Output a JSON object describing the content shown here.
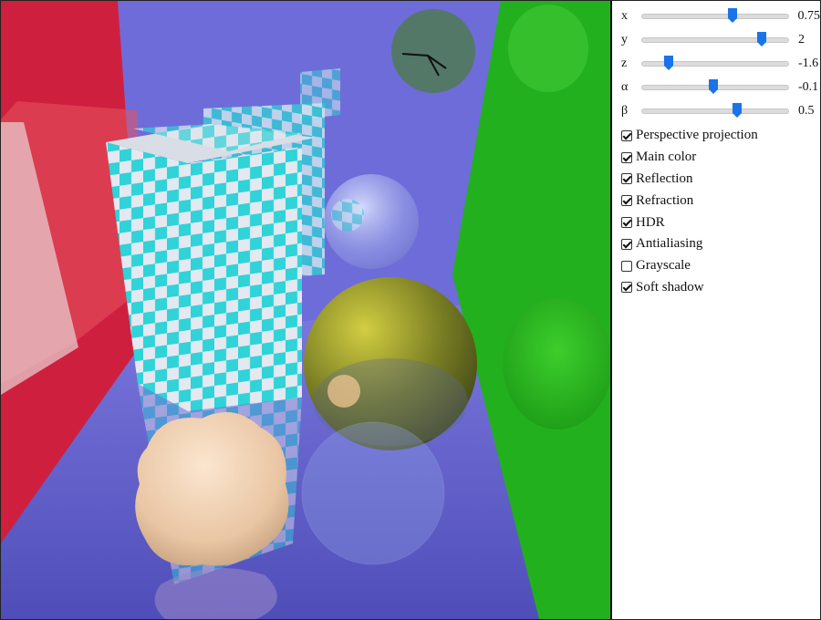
{
  "colors": {
    "left_wall": "#d01e3c",
    "back_wall": "#6a68d8",
    "floor": "#5e5cc8",
    "right_wall": "#22b01e",
    "slider_thumb": "#1a73e8"
  },
  "scene": {
    "icons": [
      "checkered-box",
      "glass-sphere",
      "olive-sphere",
      "bumpy-blob",
      "clock-sphere"
    ]
  },
  "sliders": [
    {
      "label": "x",
      "value": "0.75",
      "position": 0.62
    },
    {
      "label": "y",
      "value": "2",
      "position": 0.82
    },
    {
      "label": "z",
      "value": "-1.6",
      "position": 0.18
    },
    {
      "label": "α",
      "value": "-0.1",
      "position": 0.49
    },
    {
      "label": "β",
      "value": "0.5",
      "position": 0.65
    }
  ],
  "options": [
    {
      "label": "Perspective projection",
      "checked": true
    },
    {
      "label": "Main color",
      "checked": true
    },
    {
      "label": "Reflection",
      "checked": true
    },
    {
      "label": "Refraction",
      "checked": true
    },
    {
      "label": "HDR",
      "checked": true
    },
    {
      "label": "Antialiasing",
      "checked": true
    },
    {
      "label": "Grayscale",
      "checked": false
    },
    {
      "label": "Soft shadow",
      "checked": true
    }
  ]
}
